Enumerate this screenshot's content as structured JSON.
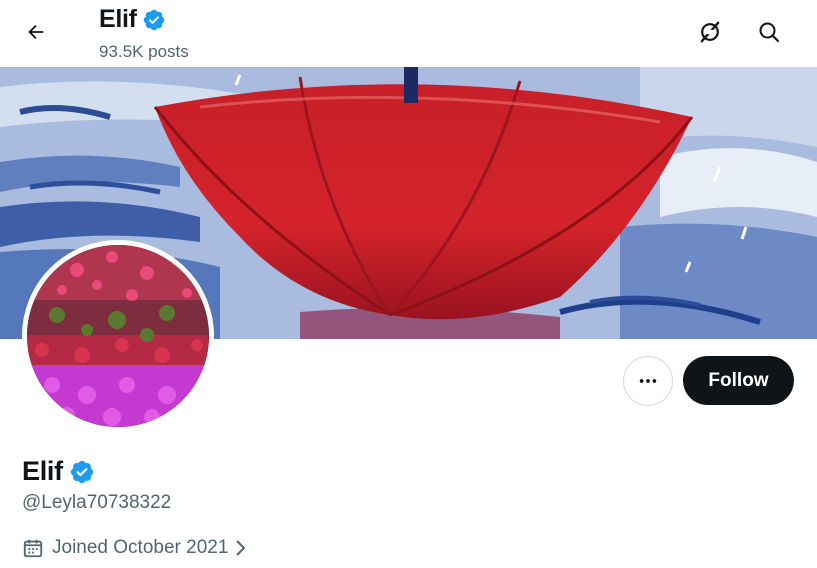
{
  "header": {
    "name": "Elif",
    "posts": "93.5K posts"
  },
  "profile": {
    "name": "Elif",
    "handle": "@Leyla70738322",
    "joined": "Joined October 2021"
  },
  "actions": {
    "follow_label": "Follow"
  },
  "colors": {
    "verified": "#1d9bf0",
    "follow_bg": "#0f1419",
    "secondary_text": "#536471"
  },
  "icons": {
    "back": "arrow-left-icon",
    "grok": "grok-icon",
    "search": "search-icon",
    "more": "more-horizontal-icon",
    "calendar": "calendar-icon",
    "chevron": "chevron-right-icon",
    "verified": "verified-badge-icon"
  }
}
